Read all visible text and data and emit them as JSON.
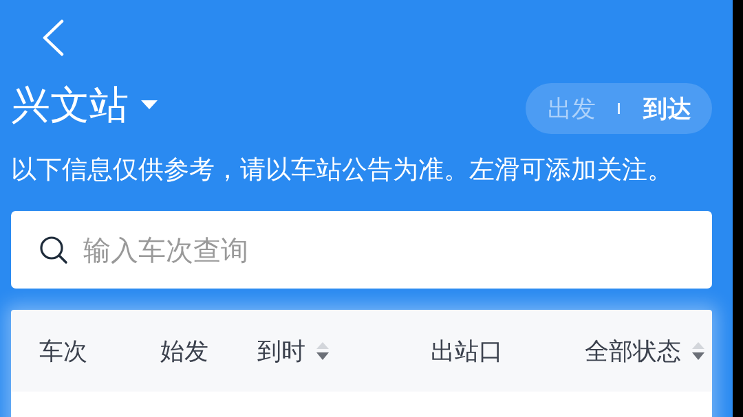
{
  "header": {
    "station": "兴文站",
    "toggle": [
      {
        "label": "出发",
        "selected": false
      },
      {
        "label": "到达",
        "selected": true
      }
    ]
  },
  "notice": "以下信息仅供参考，请以车站公告为准。左滑可添加关注。",
  "search": {
    "placeholder": "输入车次查询"
  },
  "table": {
    "columns": [
      {
        "label": "车次",
        "sortable": false
      },
      {
        "label": "始发",
        "sortable": false
      },
      {
        "label": "到时",
        "sortable": true
      },
      {
        "label": "出站口",
        "sortable": false
      },
      {
        "label": "全部状态",
        "sortable": true
      }
    ]
  }
}
